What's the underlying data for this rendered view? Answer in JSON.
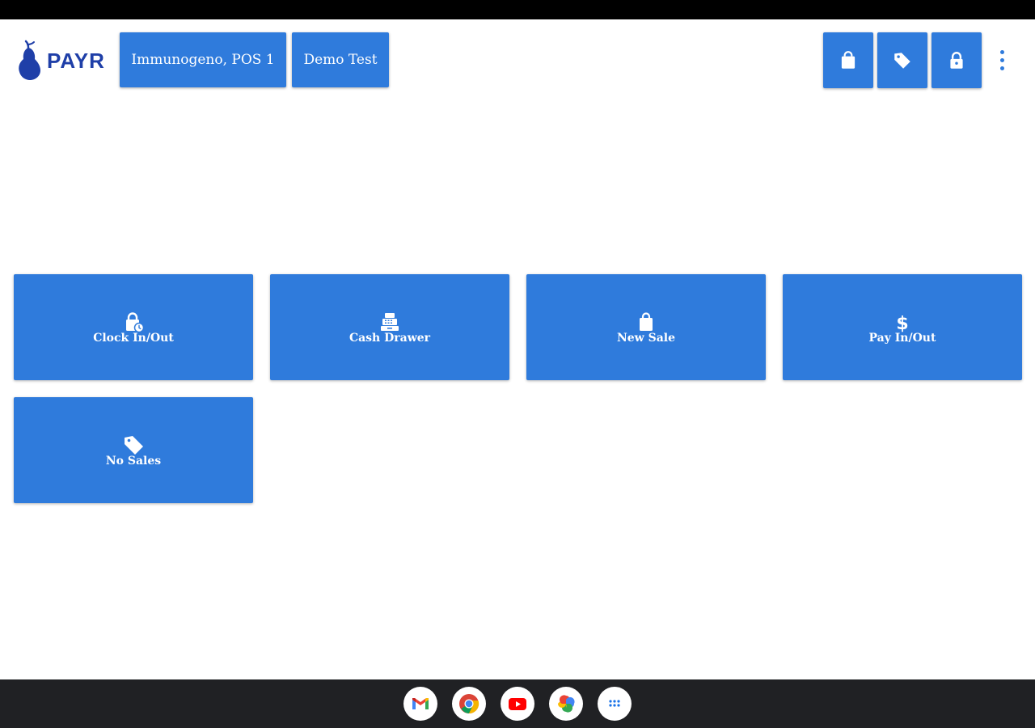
{
  "header": {
    "brand": "PAYR",
    "location_label": "Immunogeno, POS 1",
    "user_label": "Demo Test",
    "icon_buttons": [
      "shopping-bag-icon",
      "tag-icon",
      "lock-icon"
    ],
    "menu_icon": "more-vert-icon"
  },
  "tiles": [
    {
      "label": "Clock In/Out",
      "icon": "lock-clock-icon"
    },
    {
      "label": "Cash Drawer",
      "icon": "cash-register-icon"
    },
    {
      "label": "New Sale",
      "icon": "shopping-bag-icon"
    },
    {
      "label": "Pay In/Out",
      "icon": "dollar-icon"
    },
    {
      "label": "No Sales",
      "icon": "tag-icon"
    }
  ],
  "shelf": {
    "apps": [
      "gmail-icon",
      "chrome-icon",
      "youtube-icon",
      "photos-icon",
      "app-launcher-icon"
    ]
  },
  "colors": {
    "accent": "#2f7bdc",
    "brand": "#1f3fa8",
    "status_bar": "#000000",
    "taskbar": "#202124"
  }
}
